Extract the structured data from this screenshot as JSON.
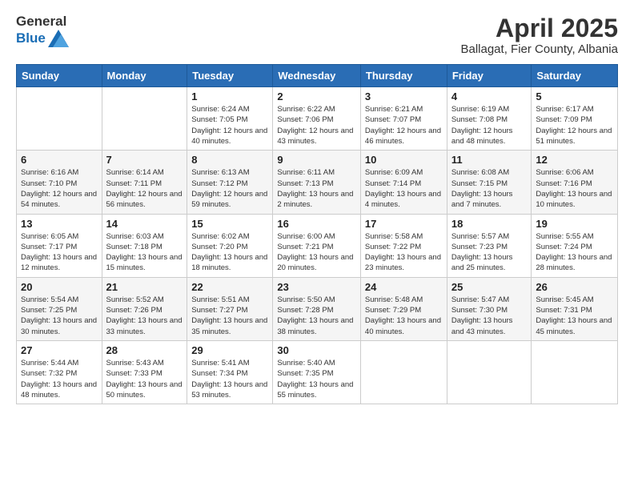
{
  "logo": {
    "general": "General",
    "blue": "Blue"
  },
  "title": {
    "month": "April 2025",
    "location": "Ballagat, Fier County, Albania"
  },
  "weekdays": [
    "Sunday",
    "Monday",
    "Tuesday",
    "Wednesday",
    "Thursday",
    "Friday",
    "Saturday"
  ],
  "weeks": [
    [
      {
        "day": "",
        "info": ""
      },
      {
        "day": "",
        "info": ""
      },
      {
        "day": "1",
        "info": "Sunrise: 6:24 AM\nSunset: 7:05 PM\nDaylight: 12 hours and 40 minutes."
      },
      {
        "day": "2",
        "info": "Sunrise: 6:22 AM\nSunset: 7:06 PM\nDaylight: 12 hours and 43 minutes."
      },
      {
        "day": "3",
        "info": "Sunrise: 6:21 AM\nSunset: 7:07 PM\nDaylight: 12 hours and 46 minutes."
      },
      {
        "day": "4",
        "info": "Sunrise: 6:19 AM\nSunset: 7:08 PM\nDaylight: 12 hours and 48 minutes."
      },
      {
        "day": "5",
        "info": "Sunrise: 6:17 AM\nSunset: 7:09 PM\nDaylight: 12 hours and 51 minutes."
      }
    ],
    [
      {
        "day": "6",
        "info": "Sunrise: 6:16 AM\nSunset: 7:10 PM\nDaylight: 12 hours and 54 minutes."
      },
      {
        "day": "7",
        "info": "Sunrise: 6:14 AM\nSunset: 7:11 PM\nDaylight: 12 hours and 56 minutes."
      },
      {
        "day": "8",
        "info": "Sunrise: 6:13 AM\nSunset: 7:12 PM\nDaylight: 12 hours and 59 minutes."
      },
      {
        "day": "9",
        "info": "Sunrise: 6:11 AM\nSunset: 7:13 PM\nDaylight: 13 hours and 2 minutes."
      },
      {
        "day": "10",
        "info": "Sunrise: 6:09 AM\nSunset: 7:14 PM\nDaylight: 13 hours and 4 minutes."
      },
      {
        "day": "11",
        "info": "Sunrise: 6:08 AM\nSunset: 7:15 PM\nDaylight: 13 hours and 7 minutes."
      },
      {
        "day": "12",
        "info": "Sunrise: 6:06 AM\nSunset: 7:16 PM\nDaylight: 13 hours and 10 minutes."
      }
    ],
    [
      {
        "day": "13",
        "info": "Sunrise: 6:05 AM\nSunset: 7:17 PM\nDaylight: 13 hours and 12 minutes."
      },
      {
        "day": "14",
        "info": "Sunrise: 6:03 AM\nSunset: 7:18 PM\nDaylight: 13 hours and 15 minutes."
      },
      {
        "day": "15",
        "info": "Sunrise: 6:02 AM\nSunset: 7:20 PM\nDaylight: 13 hours and 18 minutes."
      },
      {
        "day": "16",
        "info": "Sunrise: 6:00 AM\nSunset: 7:21 PM\nDaylight: 13 hours and 20 minutes."
      },
      {
        "day": "17",
        "info": "Sunrise: 5:58 AM\nSunset: 7:22 PM\nDaylight: 13 hours and 23 minutes."
      },
      {
        "day": "18",
        "info": "Sunrise: 5:57 AM\nSunset: 7:23 PM\nDaylight: 13 hours and 25 minutes."
      },
      {
        "day": "19",
        "info": "Sunrise: 5:55 AM\nSunset: 7:24 PM\nDaylight: 13 hours and 28 minutes."
      }
    ],
    [
      {
        "day": "20",
        "info": "Sunrise: 5:54 AM\nSunset: 7:25 PM\nDaylight: 13 hours and 30 minutes."
      },
      {
        "day": "21",
        "info": "Sunrise: 5:52 AM\nSunset: 7:26 PM\nDaylight: 13 hours and 33 minutes."
      },
      {
        "day": "22",
        "info": "Sunrise: 5:51 AM\nSunset: 7:27 PM\nDaylight: 13 hours and 35 minutes."
      },
      {
        "day": "23",
        "info": "Sunrise: 5:50 AM\nSunset: 7:28 PM\nDaylight: 13 hours and 38 minutes."
      },
      {
        "day": "24",
        "info": "Sunrise: 5:48 AM\nSunset: 7:29 PM\nDaylight: 13 hours and 40 minutes."
      },
      {
        "day": "25",
        "info": "Sunrise: 5:47 AM\nSunset: 7:30 PM\nDaylight: 13 hours and 43 minutes."
      },
      {
        "day": "26",
        "info": "Sunrise: 5:45 AM\nSunset: 7:31 PM\nDaylight: 13 hours and 45 minutes."
      }
    ],
    [
      {
        "day": "27",
        "info": "Sunrise: 5:44 AM\nSunset: 7:32 PM\nDaylight: 13 hours and 48 minutes."
      },
      {
        "day": "28",
        "info": "Sunrise: 5:43 AM\nSunset: 7:33 PM\nDaylight: 13 hours and 50 minutes."
      },
      {
        "day": "29",
        "info": "Sunrise: 5:41 AM\nSunset: 7:34 PM\nDaylight: 13 hours and 53 minutes."
      },
      {
        "day": "30",
        "info": "Sunrise: 5:40 AM\nSunset: 7:35 PM\nDaylight: 13 hours and 55 minutes."
      },
      {
        "day": "",
        "info": ""
      },
      {
        "day": "",
        "info": ""
      },
      {
        "day": "",
        "info": ""
      }
    ]
  ]
}
